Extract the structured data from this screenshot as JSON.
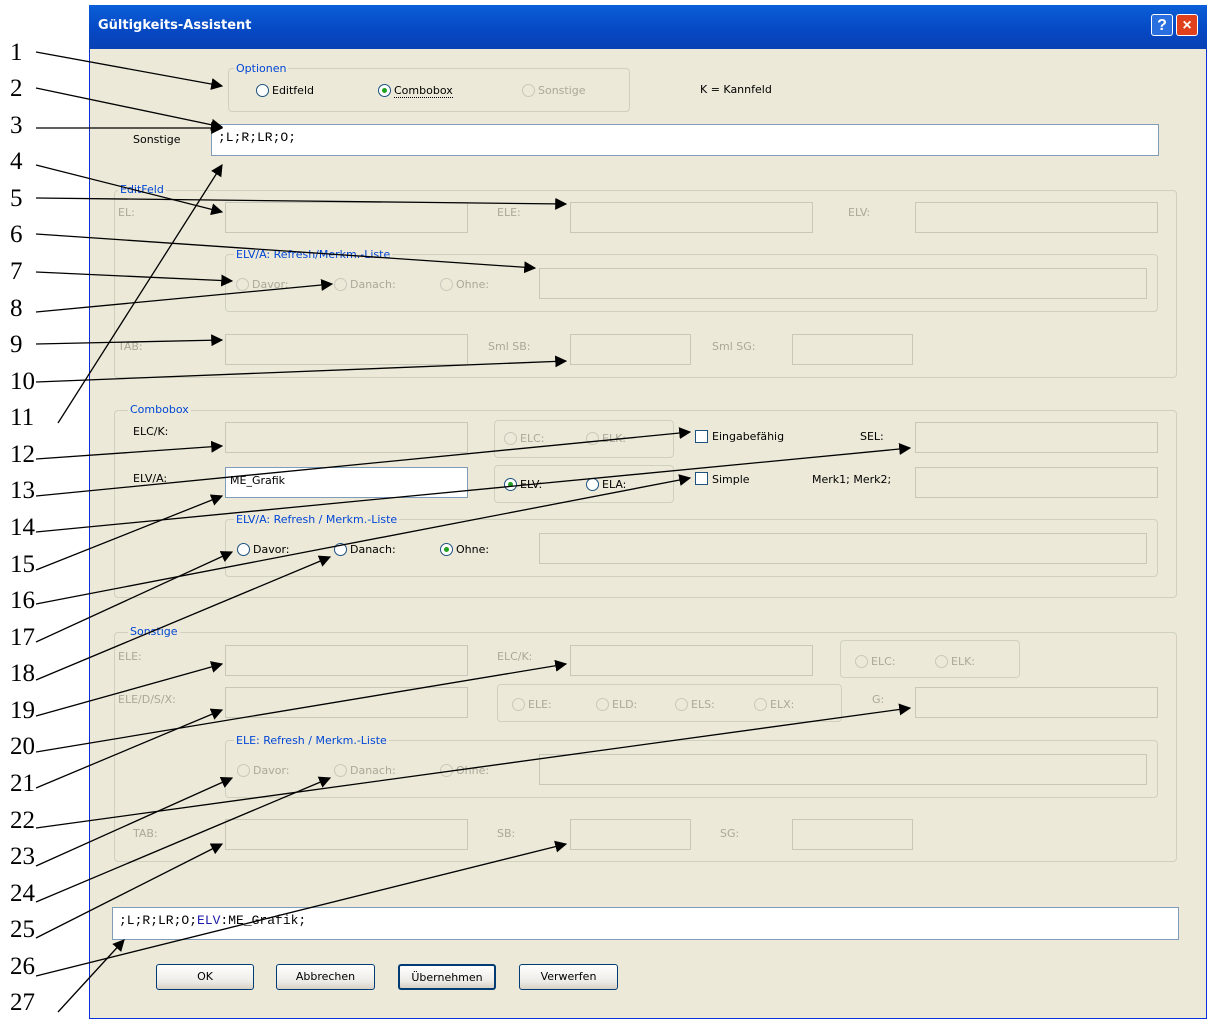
{
  "window": {
    "title": "Gültigkeits-Assistent",
    "help_label": "?",
    "close_label": "×"
  },
  "optionen": {
    "title": "Optionen",
    "radio_editfeld": "Editfeld",
    "radio_combobox": "Combobox",
    "radio_sonstige": "Sonstige",
    "note": "K = Kannfeld",
    "selected": "Combobox"
  },
  "sonstige_row": {
    "label": "Sonstige",
    "value": ";L;R;LR;O;"
  },
  "editfeld": {
    "title": "EditFeld",
    "el_label": "EL:",
    "ele_label": "ELE:",
    "elv_label": "ELV:",
    "refresh_title": "ELV/A: Refresh/Merkm.-Liste",
    "davor": "Davor:",
    "danach": "Danach:",
    "ohne": "Ohne:",
    "tab_label": "TAB:",
    "smlsb_label": "Sml SB:",
    "smlsg_label": "Sml SG:"
  },
  "combobox": {
    "title": "Combobox",
    "elck_label": "ELC/K:",
    "elc": "ELC:",
    "elk": "ELK:",
    "eingabefahig": "Eingabefähig",
    "sel_label": "SEL:",
    "elva_label": "ELV/A:",
    "elva_value": "ME_Grafik",
    "elv": "ELV:",
    "ela": "ELA:",
    "simple": "Simple",
    "merk": "Merk1; Merk2;",
    "refresh_title": "ELV/A: Refresh / Merkm.-Liste",
    "davor": "Davor:",
    "danach": "Danach:",
    "ohne": "Ohne:"
  },
  "sonstige": {
    "title": "Sonstige",
    "ele_label": "ELE:",
    "elck_label": "ELC/K:",
    "elc": "ELC:",
    "elk": "ELK:",
    "eledsx_label": "ELE/D/S/X:",
    "ele": "ELE:",
    "eld": "ELD:",
    "els": "ELS:",
    "elx": "ELX:",
    "g_label": "G:",
    "refresh_title": "ELE: Refresh / Merkm.-Liste",
    "davor": "Davor:",
    "danach": "Danach:",
    "ohne": "Ohne:",
    "tab_label": "TAB:",
    "sb_label": "SB:",
    "sg_label": "SG:"
  },
  "result": {
    "prefix": ";L;R;LR;O;",
    "keyword": "ELV",
    "suffix": ":ME_Grafik;"
  },
  "buttons": {
    "ok": "OK",
    "abbrechen": "Abbrechen",
    "ubernehmen": "Übernehmen",
    "verwerfen": "Verwerfen"
  },
  "callouts": [
    "1",
    "2",
    "3",
    "4",
    "5",
    "6",
    "7",
    "8",
    "9",
    "10",
    "11",
    "12",
    "13",
    "14",
    "15",
    "16",
    "17",
    "18",
    "19",
    "20",
    "21",
    "22",
    "23",
    "24",
    "25",
    "26",
    "27"
  ],
  "colors": {
    "title_bar": "#0a5fd8",
    "group_title": "#0046d5",
    "keyword": "#1a1aa6",
    "radio_dot": "#21a121",
    "close_button": "#e0401c"
  }
}
